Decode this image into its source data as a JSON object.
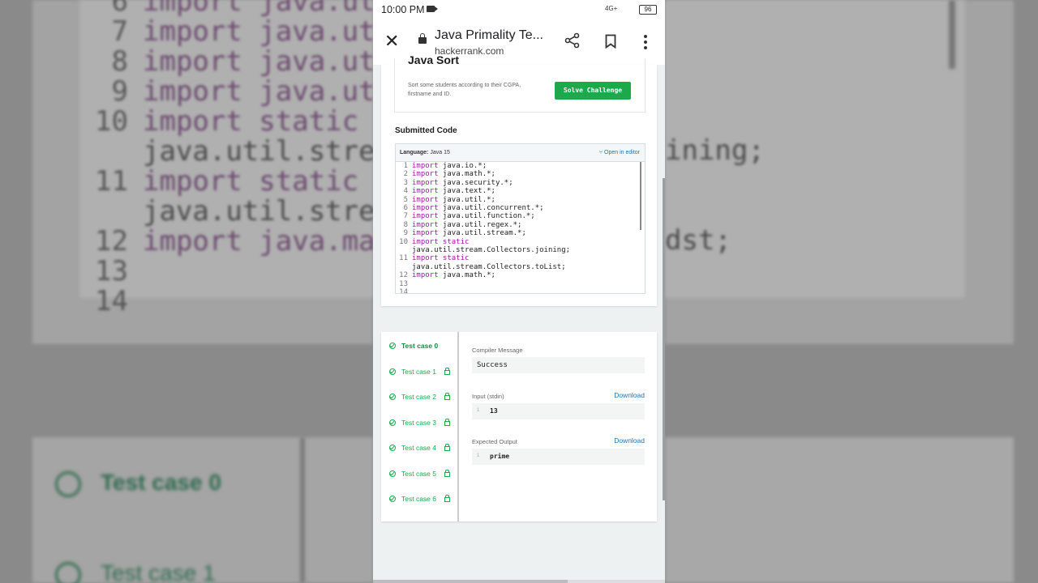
{
  "status_bar": {
    "time": "10:00 PM",
    "signal": "4G+",
    "battery": "96"
  },
  "browser": {
    "page_title": "Java Primality Te...",
    "host": "hackerrank.com"
  },
  "suggestion": {
    "name": "Java Sort",
    "description": "Sort some students according to their CGPA, firstname and ID.",
    "button": "Solve Challenge"
  },
  "submission": {
    "label": "Submitted Code",
    "language_label": "Language:",
    "language": "Java 15",
    "open_editor": "Open in editor",
    "code_lines": [
      {
        "num": "1",
        "kw": "import",
        "text": " java.io.*;"
      },
      {
        "num": "2",
        "kw": "import",
        "text": " java.math.*;"
      },
      {
        "num": "3",
        "kw": "import",
        "text": " java.security.*;"
      },
      {
        "num": "4",
        "kw": "import",
        "text": " java.text.*;"
      },
      {
        "num": "5",
        "kw": "import",
        "text": " java.util.*;"
      },
      {
        "num": "6",
        "kw": "import",
        "text": " java.util.concurrent.*;"
      },
      {
        "num": "7",
        "kw": "import",
        "text": " java.util.function.*;"
      },
      {
        "num": "8",
        "kw": "import",
        "text": " java.util.regex.*;"
      },
      {
        "num": "9",
        "kw": "import",
        "text": " java.util.stream.*;"
      },
      {
        "num": "10",
        "kw": "import static",
        "text": ""
      },
      {
        "num": "",
        "kw": "",
        "text": "java.util.stream.Collectors.joining;"
      },
      {
        "num": "11",
        "kw": "import static",
        "text": ""
      },
      {
        "num": "",
        "kw": "",
        "text": "java.util.stream.Collectors.toList;"
      },
      {
        "num": "12",
        "kw": "import",
        "text": " java.math.*;"
      },
      {
        "num": "13",
        "kw": "",
        "text": ""
      },
      {
        "num": "14",
        "kw": "",
        "text": ""
      }
    ]
  },
  "test_cases": [
    {
      "label": "Test case 0",
      "locked": false
    },
    {
      "label": "Test case 1",
      "locked": true
    },
    {
      "label": "Test case 2",
      "locked": true
    },
    {
      "label": "Test case 3",
      "locked": true
    },
    {
      "label": "Test case 4",
      "locked": true
    },
    {
      "label": "Test case 5",
      "locked": true
    },
    {
      "label": "Test case 6",
      "locked": true
    }
  ],
  "result": {
    "compiler_label": "Compiler Message",
    "compiler_message": "Success",
    "input_label": "Input (stdin)",
    "download": "Download",
    "input_line_no": "1",
    "input_value": "13",
    "expected_label": "Expected Output",
    "expected_line_no": "1",
    "expected_value": "prime"
  },
  "colors": {
    "accent_green": "#1ba94c",
    "link_blue": "#1a73b8",
    "keyword_purple": "#9b1a9b"
  }
}
